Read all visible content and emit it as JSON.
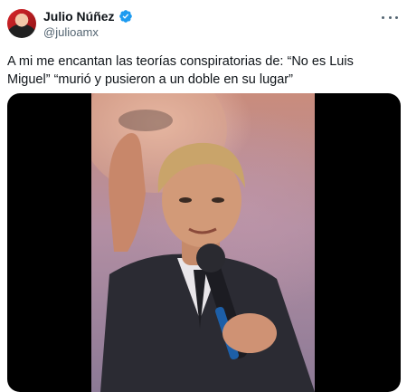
{
  "author": {
    "display_name": "Julio Núñez",
    "handle": "@julioamx"
  },
  "tweet": {
    "text": "A mi me encantan las teorías conspiratorias de: “No es Luis Miguel” “murió y pusieron a un doble en su lugar”"
  },
  "icons": {
    "verified": "verified-badge-icon",
    "more": "more-options-icon"
  },
  "colors": {
    "verified": "#1d9bf0",
    "secondary_text": "#536471"
  }
}
